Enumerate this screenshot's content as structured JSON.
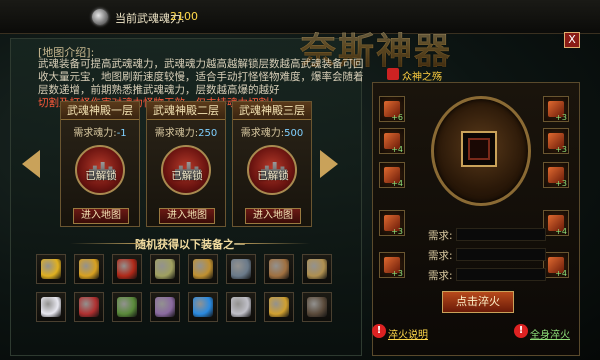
{
  "header": {
    "soul_label": "当前武魂魂力:",
    "soul_value": "2100"
  },
  "title": {
    "main": "奈斯神器",
    "sub": "众神之殇"
  },
  "close_label": "X",
  "intro": {
    "title": "[地图介绍]:",
    "text": "武魂装备可提高武魂魂力，武魂魂力越高越解锁层数越高武魂装备可回收大量元宝，地图刷新速度较慢，适合手动打怪怪物难度，爆率会随着层数递增，前期熟悉推武魂魂力，层数越高爆的越好",
    "warning": "切割及打怪伤害对魂力怪物无效，仅支持魂力切割！"
  },
  "floors": [
    {
      "title": "武魂神殿一层",
      "req_label": "需求魂力:",
      "req_value": "-1",
      "status": "已解锁",
      "button": "进入地图"
    },
    {
      "title": "武魂神殿二层",
      "req_label": "需求魂力:",
      "req_value": "250",
      "status": "已解锁",
      "button": "进入地图"
    },
    {
      "title": "武魂神殿三层",
      "req_label": "需求魂力:",
      "req_value": "500",
      "status": "已解锁",
      "button": "进入地图"
    }
  ],
  "rewards_title": "随机获得以下装备之一",
  "reward_items": [
    {
      "name": "gold-ingot-icon",
      "color": "#e0b020"
    },
    {
      "name": "golden-helmet-icon",
      "color": "#d8a020"
    },
    {
      "name": "red-helmet-icon",
      "color": "#b02818"
    },
    {
      "name": "bow-icon",
      "color": "#a0a060"
    },
    {
      "name": "dragon-helmet-icon",
      "color": "#c09030"
    },
    {
      "name": "spear-icon",
      "color": "#6a7a8a"
    },
    {
      "name": "sword-icon",
      "color": "#a07040"
    },
    {
      "name": "horned-armor-icon",
      "color": "#b09050"
    },
    {
      "name": "crystal-flower-icon",
      "color": "#e8e8f0"
    },
    {
      "name": "red-orb-icon",
      "color": "#b03030"
    },
    {
      "name": "green-scroll-icon",
      "color": "#5a8a3a"
    },
    {
      "name": "bead-bracelet-icon",
      "color": "#8a6aa0"
    },
    {
      "name": "blue-orb-icon",
      "color": "#2a8ae0"
    },
    {
      "name": "silver-ring-icon",
      "color": "#c0c0c8"
    },
    {
      "name": "gold-badge-icon",
      "color": "#d0a030"
    },
    {
      "name": "dark-armor-icon",
      "color": "#5a4a3a"
    }
  ],
  "slot_levels": [
    "+6",
    "+3",
    "+4",
    "+3",
    "+4",
    "+3",
    "+3",
    "+4",
    "+3",
    "+4"
  ],
  "requirements": [
    {
      "label": "需求:"
    },
    {
      "label": "需求:"
    },
    {
      "label": "需求:"
    }
  ],
  "forge_button": "点击淬火",
  "help_links": [
    {
      "label": "淬火说明"
    },
    {
      "label": "全身淬火"
    }
  ]
}
